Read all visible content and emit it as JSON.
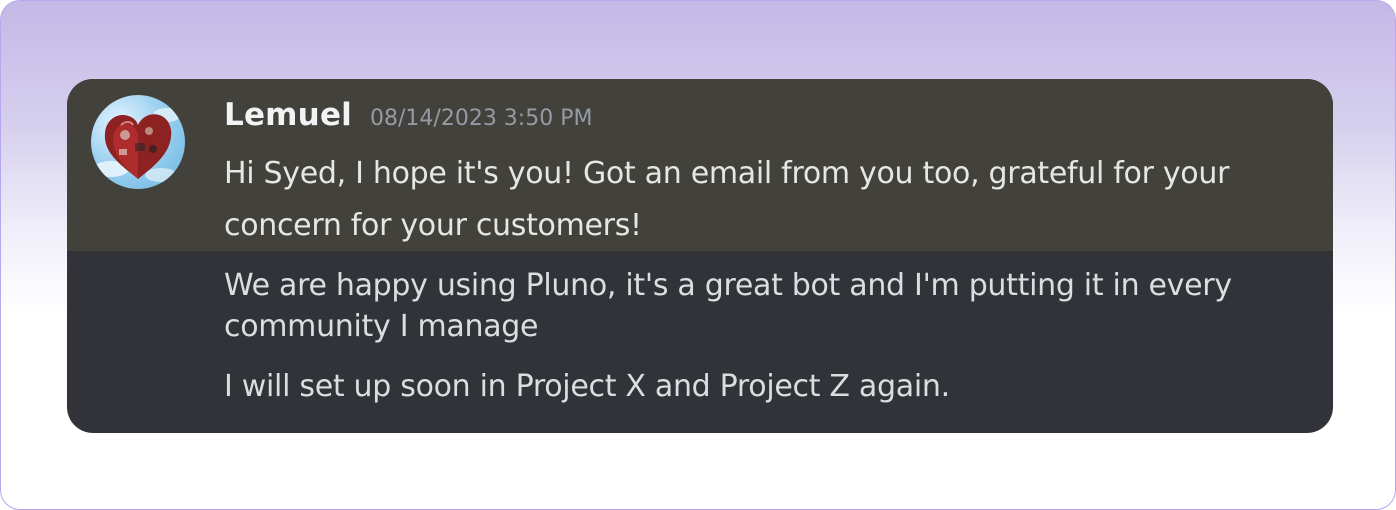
{
  "message_group": {
    "author": {
      "username": "Lemuel",
      "timestamp": "08/14/2023 3:50 PM",
      "avatar_icon": "heart-balloon-avatar"
    },
    "messages": [
      {
        "text": "Hi Syed, I hope it's you! Got an email from you too, grateful for your concern for your customers!",
        "highlighted": true
      },
      {
        "text": "We are happy using Pluno, it's a great bot and I'm putting it in every community I manage",
        "highlighted": false
      },
      {
        "text": "I will set up soon in Project X and Project Z again.",
        "highlighted": false
      }
    ]
  },
  "colors": {
    "frame_border": "#b9a6ee",
    "gradient_top": "#c3b9e6",
    "card_background": "#313338",
    "highlight_background": "#43413b",
    "username_color": "#f2f3f5",
    "timestamp_color": "#949ba4",
    "message_text_color": "#dbdee1"
  }
}
